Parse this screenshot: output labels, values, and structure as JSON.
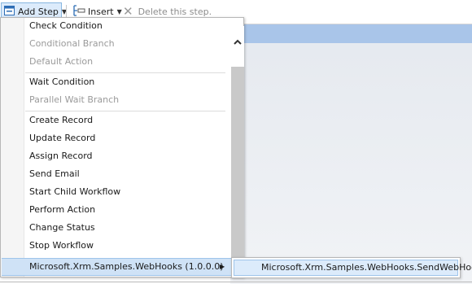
{
  "toolbar": {
    "add_step_label": "Add Step",
    "insert_label": "Insert",
    "delete_label": "Delete this step."
  },
  "menu": {
    "items": [
      {
        "label": "Check Condition",
        "enabled": true
      },
      {
        "label": "Conditional Branch",
        "enabled": false
      },
      {
        "label": "Default Action",
        "enabled": false
      },
      {
        "label": "Wait Condition",
        "enabled": true
      },
      {
        "label": "Parallel Wait Branch",
        "enabled": false
      },
      {
        "label": "Create Record",
        "enabled": true
      },
      {
        "label": "Update Record",
        "enabled": true
      },
      {
        "label": "Assign Record",
        "enabled": true
      },
      {
        "label": "Send Email",
        "enabled": true
      },
      {
        "label": "Start Child Workflow",
        "enabled": true
      },
      {
        "label": "Perform Action",
        "enabled": true
      },
      {
        "label": "Change Status",
        "enabled": true
      },
      {
        "label": "Stop Workflow",
        "enabled": true
      }
    ],
    "plugin_group": "Microsoft.Xrm.Samples.WebHooks (1.0.0.0)"
  },
  "submenu": {
    "items": [
      "Microsoft.Xrm.Samples.WebHooks.SendWebHook"
    ]
  },
  "colors": {
    "highlight": "#cfe2f6",
    "header_band": "#a9c5e9",
    "disabled_text": "#9a9a9a"
  }
}
